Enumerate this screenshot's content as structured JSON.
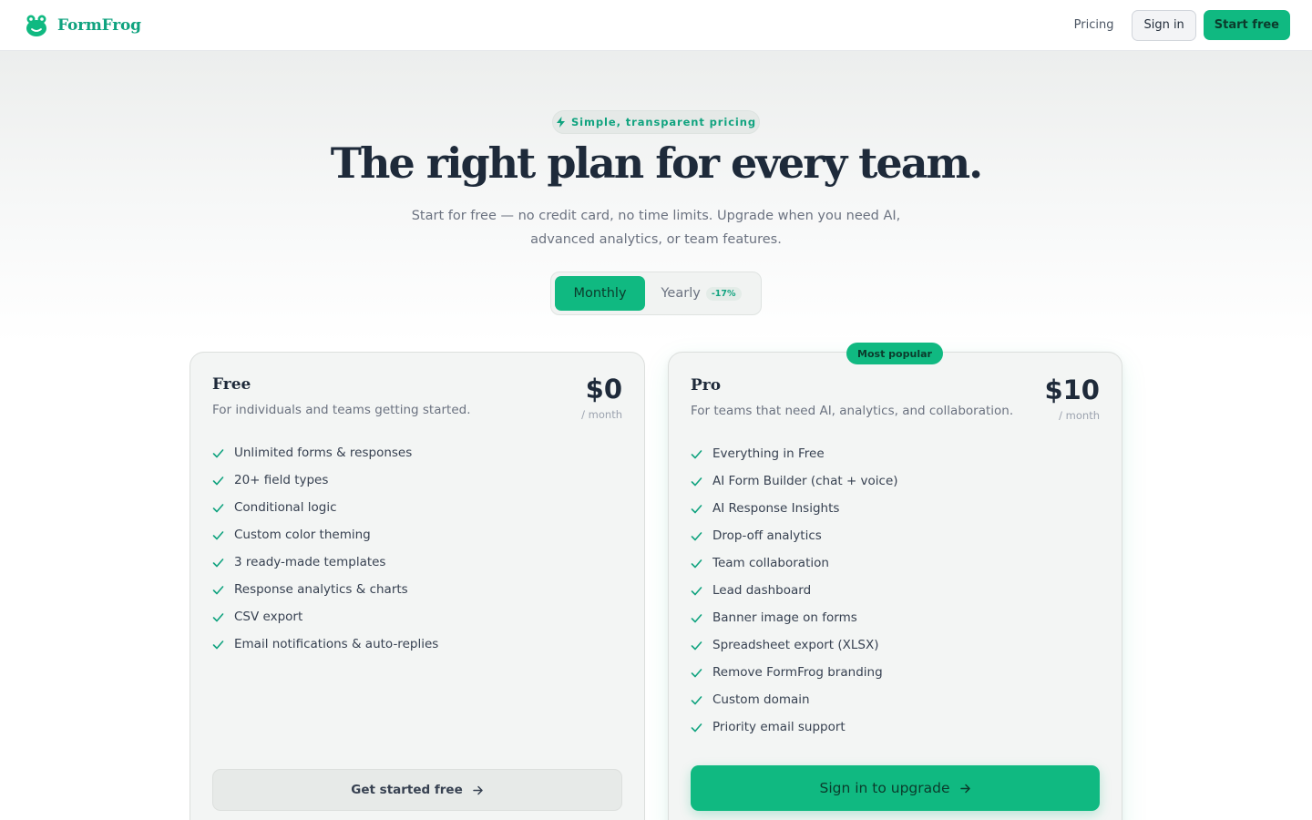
{
  "brand": {
    "name": "FormFrog",
    "logo_icon": "frog-icon"
  },
  "nav": {
    "pricing": "Pricing",
    "sign_in": "Sign in",
    "start_free": "Start free"
  },
  "hero": {
    "pill": "Simple, transparent pricing",
    "pill_icon": "lightning-icon",
    "title": "The right plan for every team.",
    "subtitle_line1": "Start for free — no credit card, no time limits. Upgrade when you need AI,",
    "subtitle_line2": "advanced analytics, or team features."
  },
  "billing_toggle": {
    "monthly": "Monthly",
    "yearly": "Yearly",
    "yearly_discount": "-17%",
    "selected": "Monthly"
  },
  "plans": [
    {
      "name": "Free",
      "description": "For individuals and teams getting started.",
      "price": "$0",
      "period": "/ month",
      "features": [
        "Unlimited forms & responses",
        "20+ field types",
        "Conditional logic",
        "Custom color theming",
        "3 ready-made templates",
        "Response analytics & charts",
        "CSV export",
        "Email notifications & auto-replies"
      ],
      "cta": "Get started free"
    },
    {
      "name": "Pro",
      "badge": "Most popular",
      "description": "For teams that need AI, analytics, and collaboration.",
      "price": "$10",
      "period": "/ month",
      "features": [
        "Everything in Free",
        "AI Form Builder (chat + voice)",
        "AI Response Insights",
        "Drop-off analytics",
        "Team collaboration",
        "Lead dashboard",
        "Banner image on forms",
        "Spreadsheet export (XLSX)",
        "Remove FormFrog branding",
        "Custom domain",
        "Priority email support"
      ],
      "cta": "Sign in to upgrade"
    }
  ],
  "colors": {
    "accent": "#10b981",
    "brand_text": "#10a37f",
    "heading": "#1e2a3a"
  }
}
